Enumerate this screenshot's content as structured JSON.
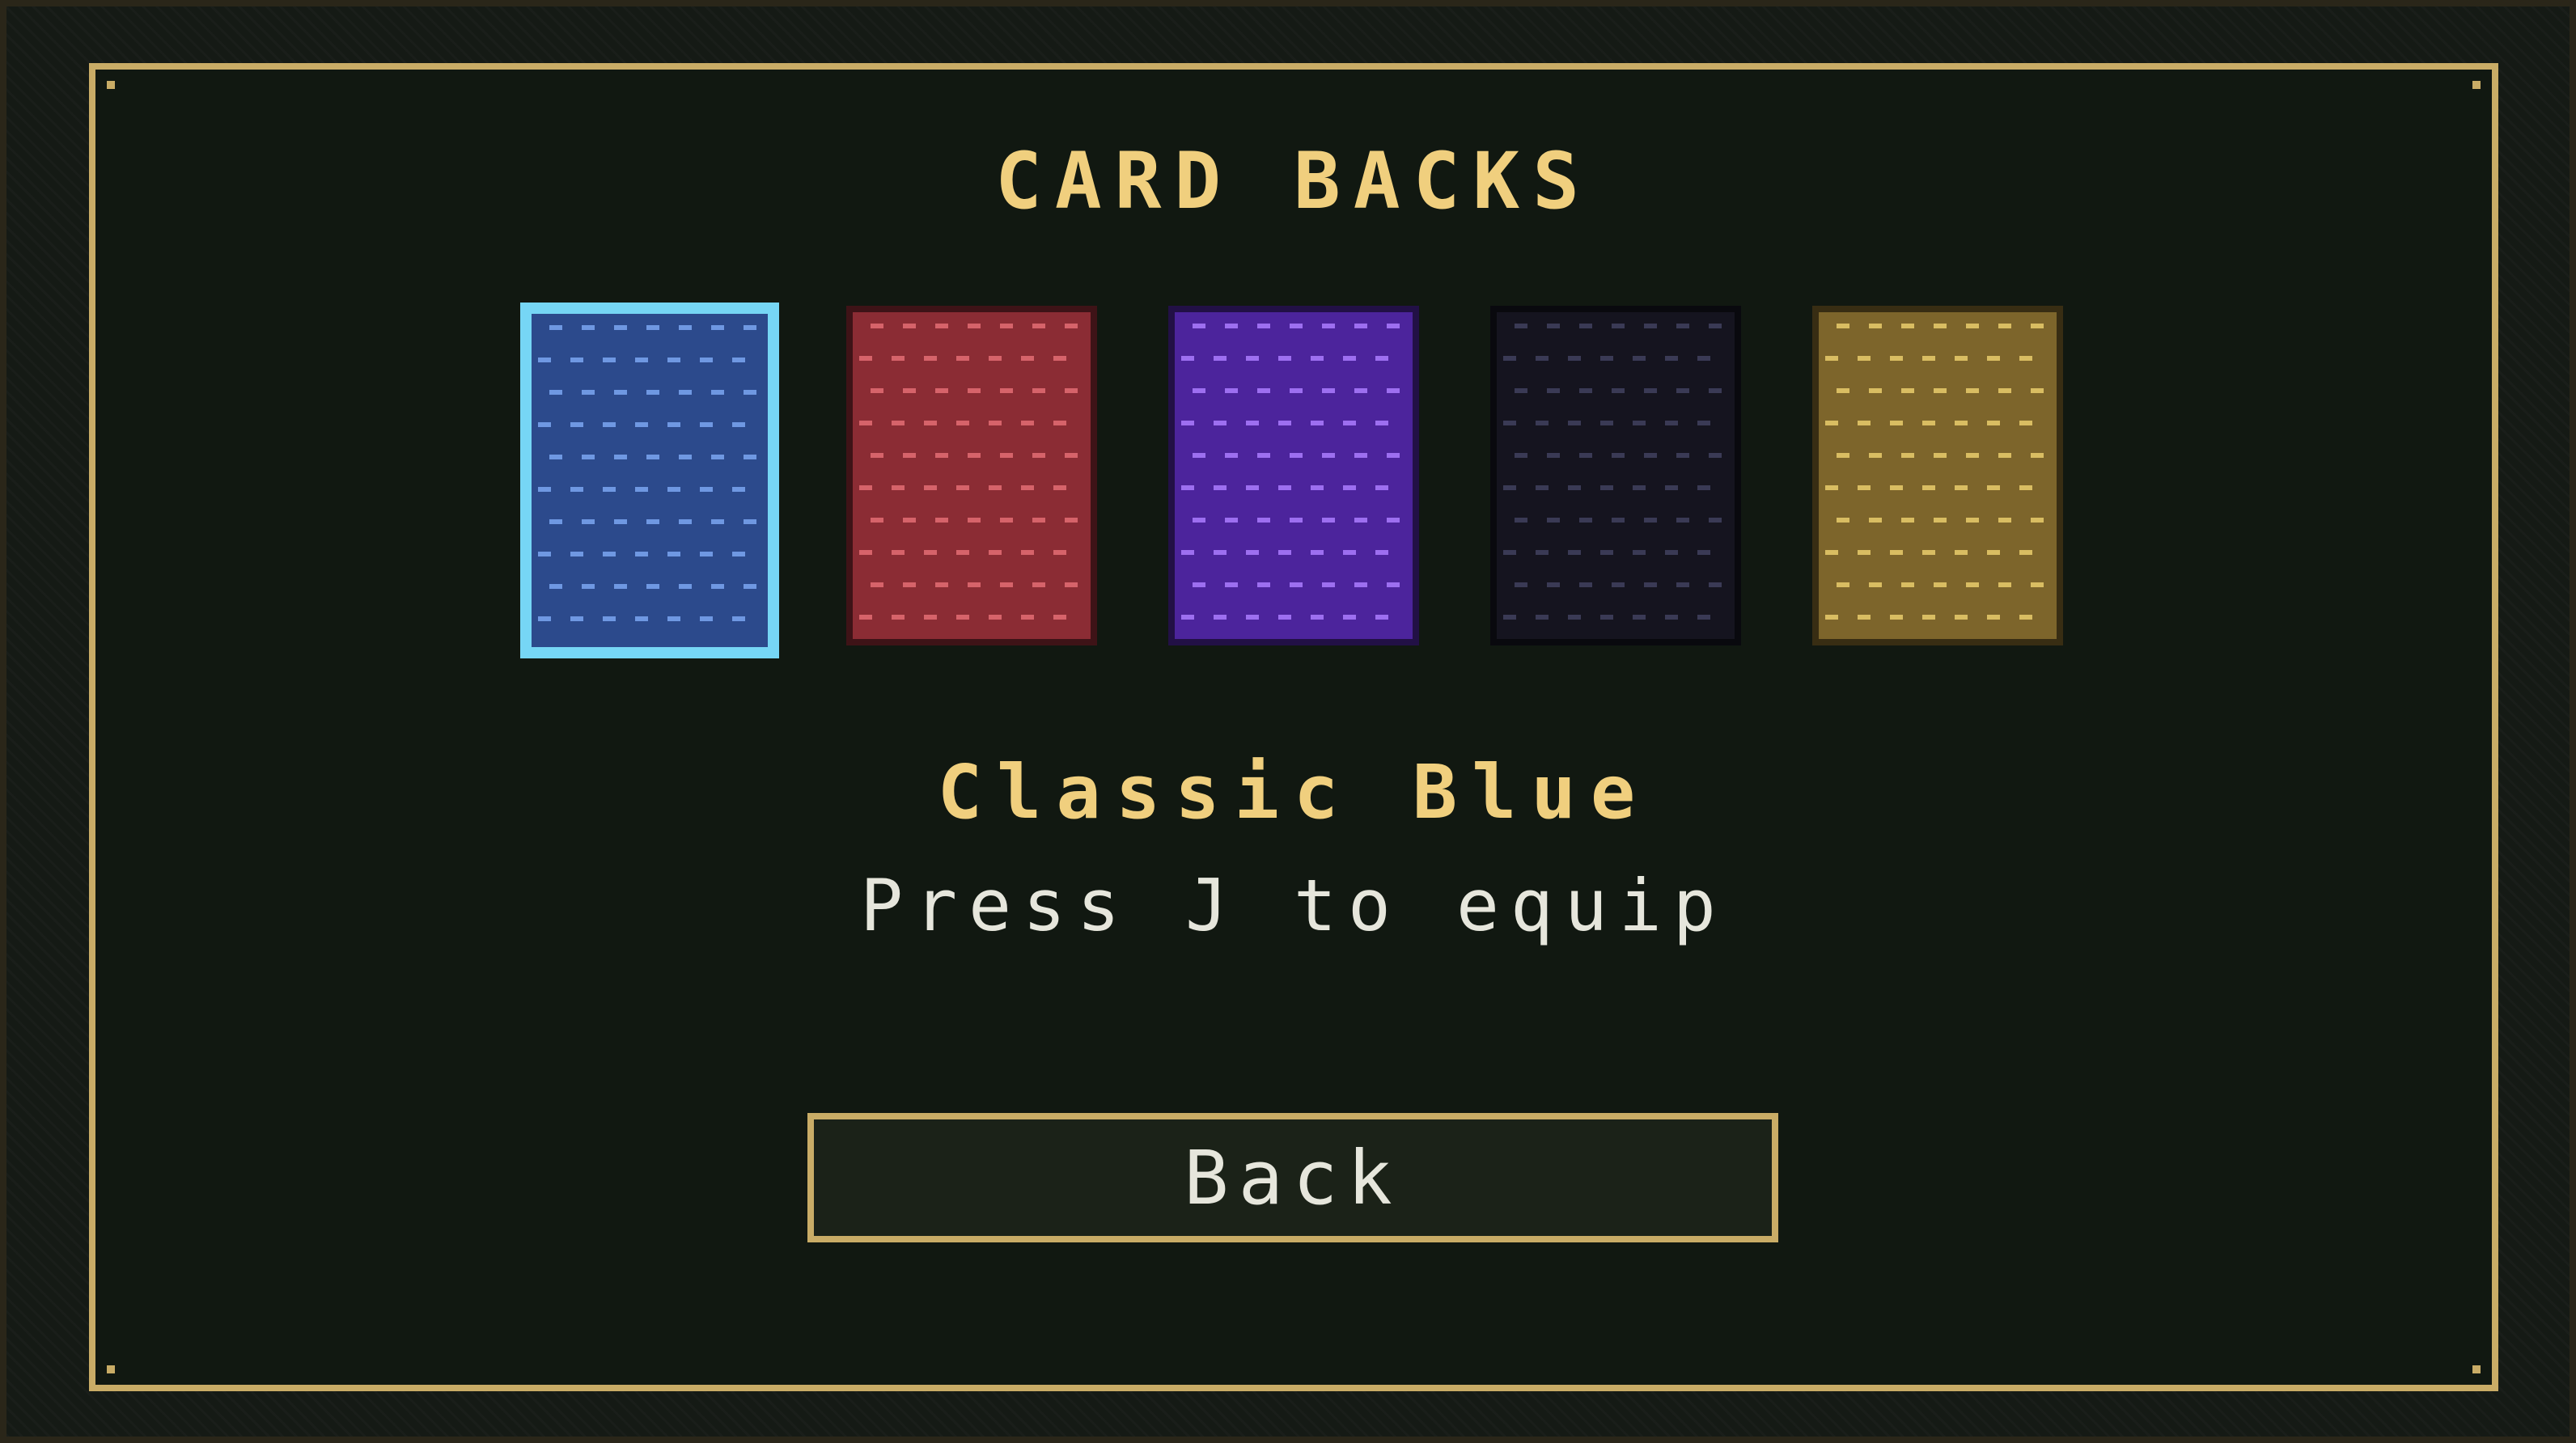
{
  "title": "CARD BACKS",
  "cards": [
    {
      "name": "Classic Blue",
      "base": "#2c4a8c",
      "dash": "#6f98e2",
      "selected": true,
      "icon": "card-back-blue"
    },
    {
      "name": "red",
      "base": "#8b2c34",
      "dash": "#d6636a",
      "selected": false,
      "icon": "card-back-red"
    },
    {
      "name": "purple",
      "base": "#4c249c",
      "dash": "#9d6ff0",
      "selected": false,
      "icon": "card-back-purple"
    },
    {
      "name": "black",
      "base": "#15141f",
      "dash": "#3a3a55",
      "selected": false,
      "icon": "card-back-black"
    },
    {
      "name": "gold",
      "base": "#7d652b",
      "dash": "#d9bd62",
      "selected": false,
      "icon": "card-back-gold"
    }
  ],
  "selected_name": "Classic Blue",
  "hint": "Press J to equip",
  "back_label": "Back",
  "colors": {
    "accent_gold": "#c9ac66",
    "title_gold": "#f0cf7e",
    "selection_cyan": "#76d6f5",
    "panel_bg": "#111811",
    "text_light": "#e6e6dc"
  }
}
